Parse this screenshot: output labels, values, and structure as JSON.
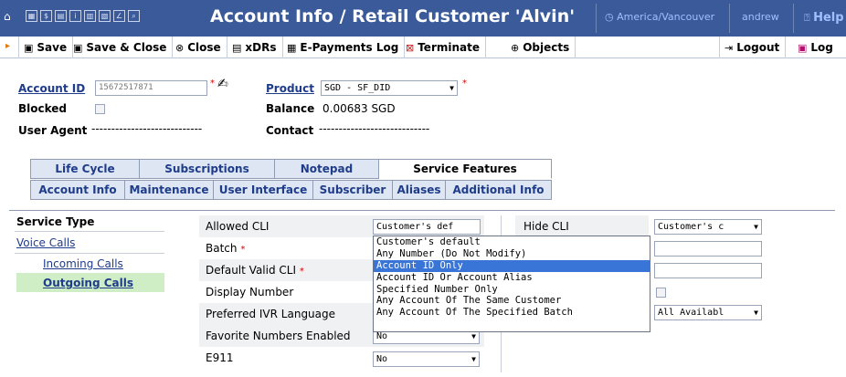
{
  "header": {
    "title": "Account Info / Retail Customer 'Alvin'",
    "timezone": "America/Vancouver",
    "user": "andrew",
    "help": "Help"
  },
  "toolbar": {
    "save": "Save",
    "save_close": "Save & Close",
    "close": "Close",
    "xdrs": "xDRs",
    "epayments": "E-Payments Log",
    "terminate": "Terminate",
    "objects": "Objects",
    "logout": "Logout",
    "log": "Log"
  },
  "account": {
    "id_label": "Account ID",
    "id_value": "15672517871",
    "product_label": "Product",
    "product_value": "SGD - SF_DID",
    "blocked_label": "Blocked",
    "balance_label": "Balance",
    "balance_value": "0.00683 SGD",
    "user_agent_label": "User Agent",
    "user_agent_value": "----------------------------",
    "contact_label": "Contact",
    "contact_value": "----------------------------"
  },
  "tabs_row1": [
    "Life Cycle",
    "Subscriptions",
    "Notepad",
    "Service Features"
  ],
  "tabs_row2": [
    "Account Info",
    "Maintenance",
    "User Interface",
    "Subscriber",
    "Aliases",
    "Additional Info"
  ],
  "sidebar": {
    "heading": "Service Type",
    "voice": "Voice Calls",
    "incoming": "Incoming Calls",
    "outgoing": "Outgoing Calls"
  },
  "fields": {
    "allowed_cli": "Allowed CLI",
    "allowed_cli_value": "Customer's def",
    "batch": "Batch",
    "default_valid_cli": "Default Valid CLI",
    "display_number": "Display Number",
    "preferred_ivr": "Preferred IVR Language",
    "favorite_numbers": "Favorite Numbers Enabled",
    "favorite_numbers_value": "No",
    "e911": "E911",
    "e911_value": "No",
    "hide_cli": "Hide CLI",
    "hide_cli_value": "Customer's c",
    "ivr_value": "All Availabl"
  },
  "dropdown_options": [
    "Customer's default",
    "Any Number (Do Not Modify)",
    "Account ID Only",
    "Account ID Or Account Alias",
    "Specified Number Only",
    "Any Account Of The Same Customer",
    "Any Account Of The Specified Batch"
  ],
  "dropdown_highlighted": "Account ID Only",
  "required_mark": "*"
}
